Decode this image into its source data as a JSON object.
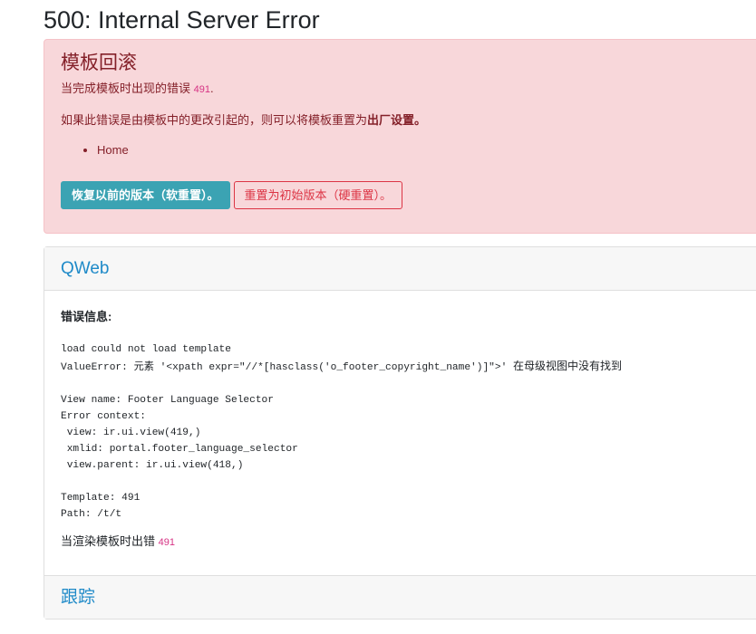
{
  "page": {
    "title": "500: Internal Server Error"
  },
  "alert": {
    "heading": "模板回滚",
    "subtext": "当完成模板时出现的错误",
    "template_id": "491",
    "subtext_end": ".",
    "hint_prefix": "如果此错误是由模板中的更改引起的，则可以将模板重置为",
    "hint_strong": "出厂设置。",
    "links": [
      "Home"
    ],
    "buttons": {
      "soft_reset": "恢复以前的版本（软重置）。",
      "hard_reset": "重置为初始版本（硬重置）。"
    },
    "colors": {
      "background": "#f8d7da",
      "text": "#842029",
      "primary_button": "#3ba3b3",
      "danger": "#dc3545"
    }
  },
  "qweb": {
    "header_title": "QWeb",
    "error_label": "错误信息:",
    "trace_line1": "load could not load template",
    "trace_line2_prefix": "ValueError: 元素 '<xpath expr=\"//*[hasclass('o_footer_copyright_name')]\">'",
    "trace_line2_suffix": "在母级视图中没有找到",
    "trace_rest": "\nView name: Footer Language Selector\nError context:\n view: ir.ui.view(419,)\n xmlid: portal.footer_language_selector\n view.parent: ir.ui.view(418,)\n\nTemplate: 491\nPath: /t/t",
    "render_error": "当渲染模板时出错",
    "render_template_id": "491",
    "footer_title": "跟踪"
  }
}
